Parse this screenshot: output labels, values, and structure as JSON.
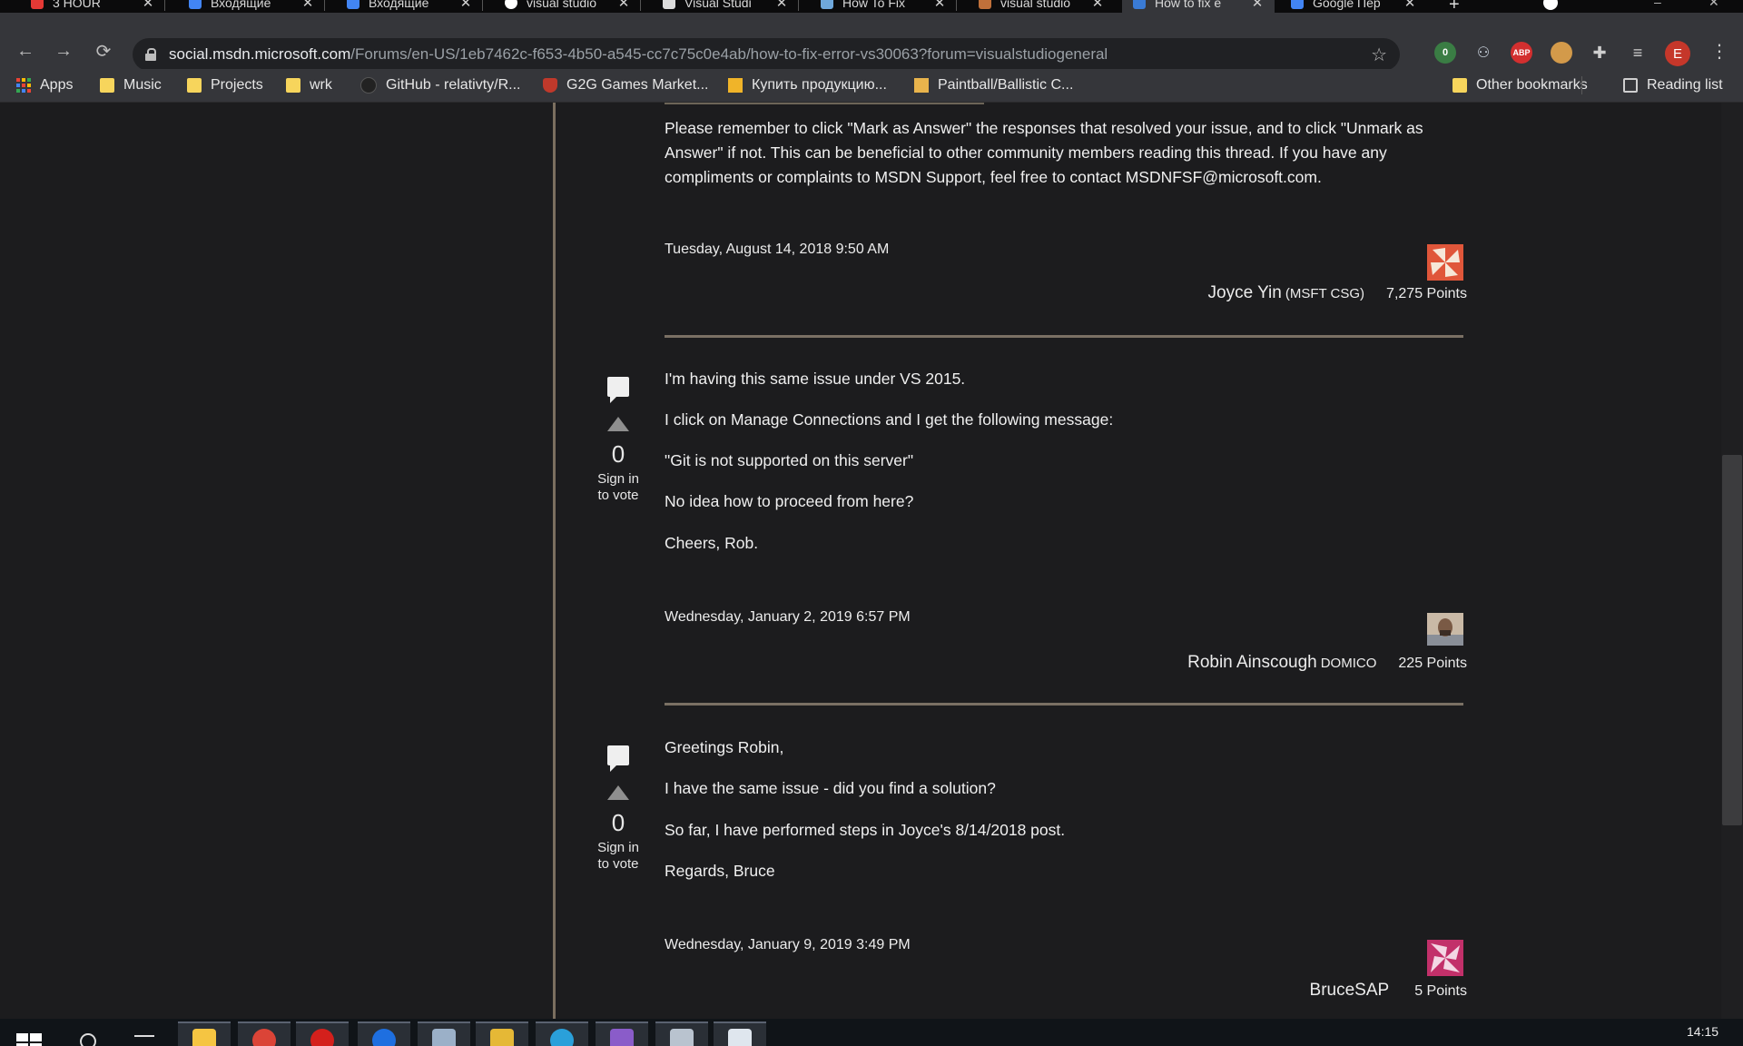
{
  "browser": {
    "tabs": [
      {
        "title": "3 HOUR",
        "color": "#e53935"
      },
      {
        "title": "Входящие",
        "color": "#4285f4"
      },
      {
        "title": "Входящие",
        "color": "#4285f4"
      },
      {
        "title": "visual studio",
        "color": "#ffffff"
      },
      {
        "title": "Visual Studi",
        "color": "#dddddd"
      },
      {
        "title": "How To Fix",
        "color": "#6fa8dc"
      },
      {
        "title": "visual studio",
        "color": "#c0703a"
      },
      {
        "title": "How to fix e",
        "color": "#3a7bd5",
        "active": true
      },
      {
        "title": "Google Пер",
        "color": "#4285f4"
      }
    ],
    "url": {
      "host": "social.msdn.microsoft.com",
      "path": "/Forums/en-US/1eb7462c-f653-4b50-a545-cc7c75c0e4ab/how-to-fix-error-vs30063?forum=visualstudiogeneral"
    },
    "profile_initial": "E",
    "extensions": [
      {
        "name": "shield-badge-icon",
        "label": "0"
      },
      {
        "name": "extension-icon",
        "label": ""
      },
      {
        "name": "adblock-icon",
        "label": "ABP"
      },
      {
        "name": "cookie-icon",
        "label": ""
      },
      {
        "name": "puzzle-icon",
        "label": ""
      },
      {
        "name": "playlist-icon",
        "label": ""
      }
    ]
  },
  "bookmarks": [
    {
      "label": "Apps",
      "type": "apps"
    },
    {
      "label": "Music",
      "type": "folder"
    },
    {
      "label": "Projects",
      "type": "folder"
    },
    {
      "label": "wrk",
      "type": "folder"
    },
    {
      "label": "GitHub - relativty/R...",
      "type": "github"
    },
    {
      "label": "G2G Games Market...",
      "type": "shield"
    },
    {
      "label": "Купить продукцию...",
      "type": "site"
    },
    {
      "label": "Paintball/Ballistic C...",
      "type": "site"
    },
    {
      "label": "Other bookmarks",
      "type": "folder"
    },
    {
      "label": "Reading list",
      "type": "reading"
    }
  ],
  "intro_text": "Please remember to click \"Mark as Answer\" the responses that resolved your issue, and to click \"Unmark as Answer\" if not. This can be beneficial to other community members reading this thread. If you have any compliments or complaints to MSDN Support, feel free to contact MSDNFSF@microsoft.com.",
  "posts": [
    {
      "date": "Tuesday, August 14, 2018 9:50 AM",
      "author": "Joyce Yin",
      "org": "(MSFT CSG)",
      "points": "7,275 Points",
      "avatar_color": "#e0563a"
    },
    {
      "votes": "0",
      "vote_label": "Sign in to vote",
      "lines": [
        "I'm having this same issue under VS 2015.",
        "I click on Manage Connections and I get the following message:",
        "\"Git is not supported on this server\"",
        "No idea how to proceed from here?",
        "Cheers, Rob."
      ],
      "date": "Wednesday, January 2, 2019 6:57 PM",
      "author": "Robin Ainscough",
      "org": "DOMICO",
      "points": "225 Points",
      "avatar_color": "#b7a493"
    },
    {
      "votes": "0",
      "vote_label": "Sign in to vote",
      "lines": [
        "Greetings Robin,",
        " I have the same issue - did you find a solution?",
        " So far, I have performed steps in Joyce's 8/14/2018 post.",
        "Regards, Bruce"
      ],
      "date": "Wednesday, January 9, 2019 3:49 PM",
      "author": "BruceSAP",
      "org": "",
      "points": "5 Points",
      "avatar_color": "#c2306a"
    }
  ],
  "taskbar": {
    "time": "14:15",
    "apps": [
      {
        "name": "file-explorer-icon",
        "color": "#f5c542"
      },
      {
        "name": "chrome-icon",
        "color": "#db4437"
      },
      {
        "name": "opera-icon",
        "color": "#d4201c"
      },
      {
        "name": "app-blue-icon",
        "color": "#1e6fe0"
      },
      {
        "name": "notepad-icon",
        "color": "#9bb0c8"
      },
      {
        "name": "folder-app-icon",
        "color": "#e5b836"
      },
      {
        "name": "telegram-icon",
        "color": "#2aa0da"
      },
      {
        "name": "visual-studio-icon",
        "color": "#8a5cc9"
      },
      {
        "name": "mail-app-icon",
        "color": "#b9c3cf"
      },
      {
        "name": "vs-installer-icon",
        "color": "#dfe6ee"
      }
    ]
  }
}
